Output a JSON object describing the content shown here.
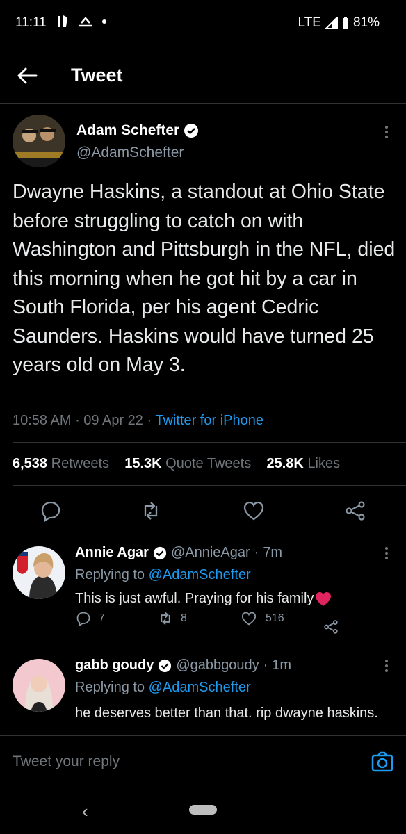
{
  "status_bar": {
    "time": "11:11",
    "network": "LTE",
    "battery": "81%"
  },
  "header": {
    "title": "Tweet"
  },
  "main_tweet": {
    "author_name": "Adam Schefter",
    "handle": "@AdamSchefter",
    "text": "Dwayne Haskins, a standout at Ohio State before struggling to catch on with Washington and Pittsburgh in the NFL, died this morning when he got hit by a car in South Florida, per his agent Cedric Saunders. Haskins would have turned 25 years old on May 3.",
    "time": "10:58 AM",
    "date": "09 Apr 22",
    "source": "Twitter for iPhone",
    "retweets_count": "6,538",
    "retweets_label": "Retweets",
    "quotes_count": "15.3K",
    "quotes_label": "Quote Tweets",
    "likes_count": "25.8K",
    "likes_label": "Likes"
  },
  "replies": [
    {
      "name": "Annie Agar",
      "handle": "@AnnieAgar",
      "age": "7m",
      "replying_label": "Replying to",
      "replying_to": "@AdamSchefter",
      "text": "This is just awful. Praying for his family",
      "reply_count": "7",
      "retweet_count": "8",
      "like_count": "516"
    },
    {
      "name": "gabb goudy",
      "handle": "@gabbgoudy",
      "age": "1m",
      "replying_label": "Replying to",
      "replying_to": "@AdamSchefter",
      "text": "he deserves better than that. rip dwayne haskins."
    }
  ],
  "compose": {
    "placeholder": "Tweet your reply"
  },
  "colors": {
    "accent": "#1d9bf0",
    "background": "#000000",
    "muted": "#71767b",
    "heart": "#e0245e"
  }
}
